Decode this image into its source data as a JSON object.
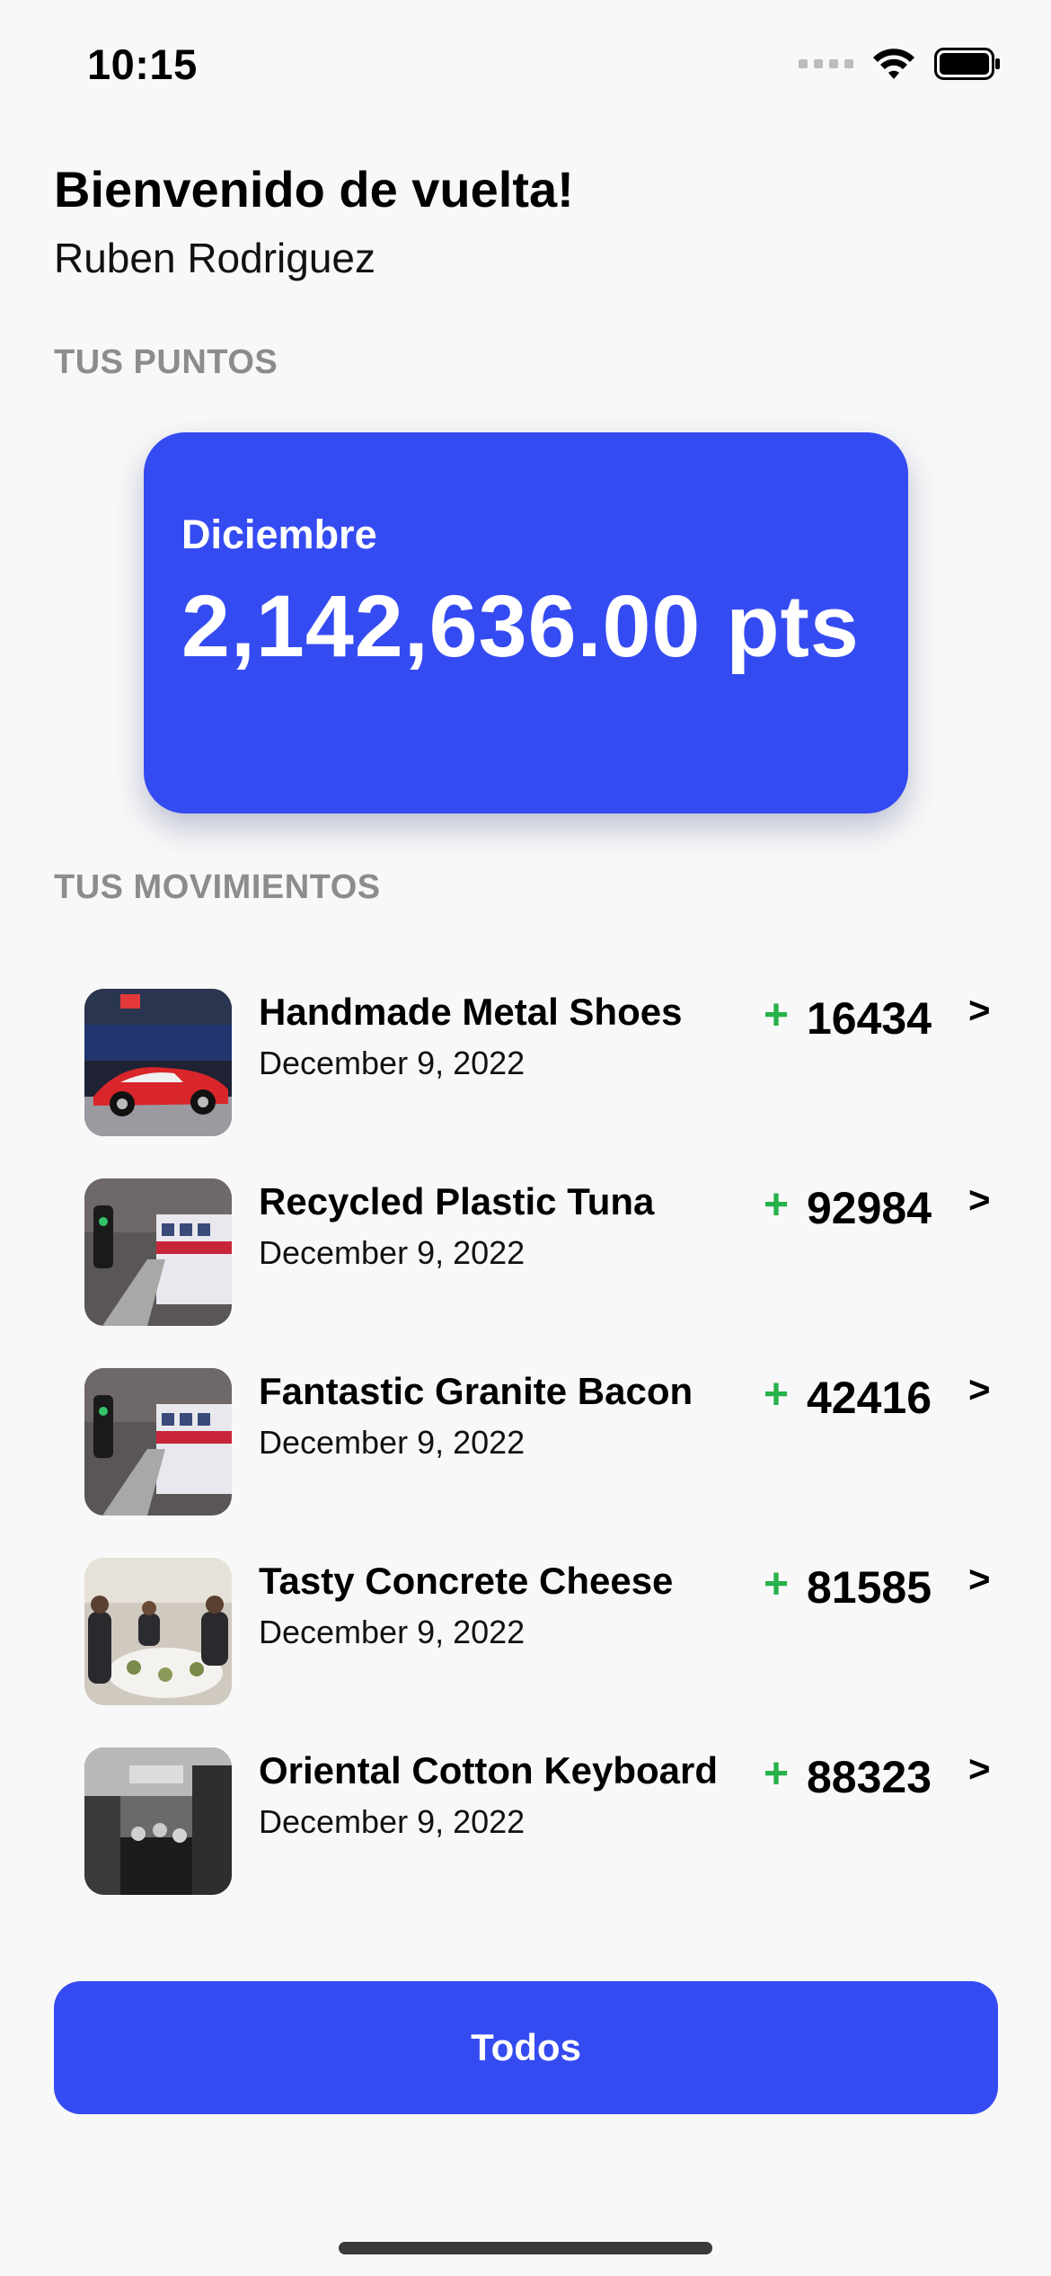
{
  "status_bar": {
    "time": "10:15",
    "icons": [
      "cellular-icon",
      "wifi-icon",
      "battery-icon"
    ]
  },
  "header": {
    "greeting": "Bienvenido de vuelta!",
    "user_name": "Ruben Rodriguez"
  },
  "points": {
    "section_label": "TUS PUNTOS",
    "month": "Diciembre",
    "value": "2,142,636.00 pts"
  },
  "movements": {
    "section_label": "TUS MOVIMIENTOS",
    "items": [
      {
        "title": "Handmade Metal Shoes",
        "date": "December 9, 2022",
        "sign": "+",
        "amount": "16434",
        "chevron": ">",
        "image": "red-sports-car"
      },
      {
        "title": "Recycled Plastic Tuna",
        "date": "December 9, 2022",
        "sign": "+",
        "amount": "92984",
        "chevron": ">",
        "image": "train-station"
      },
      {
        "title": "Fantastic Granite Bacon",
        "date": "December 9, 2022",
        "sign": "+",
        "amount": "42416",
        "chevron": ">",
        "image": "train-station"
      },
      {
        "title": "Tasty Concrete Cheese",
        "date": "December 9, 2022",
        "sign": "+",
        "amount": "81585",
        "chevron": ">",
        "image": "dinner-table"
      },
      {
        "title": "Oriental Cotton Keyboard",
        "date": "December 9, 2022",
        "sign": "+",
        "amount": "88323",
        "chevron": ">",
        "image": "black-white-street"
      }
    ]
  },
  "button": {
    "label": "Todos"
  },
  "colors": {
    "accent": "#354bf2",
    "positive": "#27b14a",
    "muted_label": "#8c8c8c",
    "background": "#f8f8f8"
  }
}
